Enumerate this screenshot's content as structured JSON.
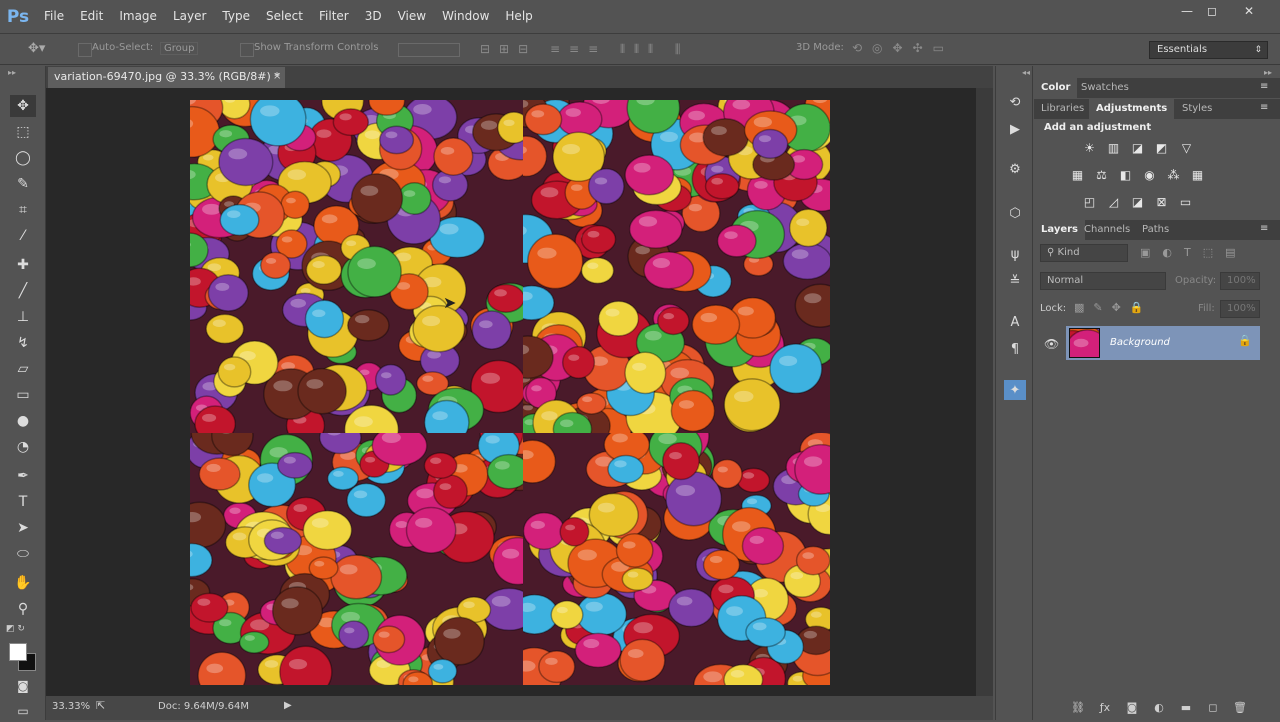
{
  "app": {
    "logo": "Ps",
    "menu": [
      "File",
      "Edit",
      "Image",
      "Layer",
      "Type",
      "Select",
      "Filter",
      "3D",
      "View",
      "Window",
      "Help"
    ],
    "window_controls": {
      "minimize": "—",
      "maximize": "◻",
      "close": "✕"
    }
  },
  "options_bar": {
    "auto_select": "Auto-Select:",
    "group_label": "Group",
    "show_transform": "Show Transform Controls",
    "mode_label": "3D Mode:",
    "workspace": "Essentials"
  },
  "document": {
    "tab_title": "variation-69470.jpg @ 33.3% (RGB/8#) *",
    "tab_close": "×"
  },
  "status": {
    "zoom": "33.33%",
    "doc_info": "Doc: 9.64M/9.64M"
  },
  "panels": {
    "top_tabs": [
      "Color",
      "Swatches"
    ],
    "mid_tabs": [
      "Libraries",
      "Adjustments",
      "Styles"
    ],
    "adjustments_title": "Add an adjustment",
    "layers_tabs": [
      "Layers",
      "Channels",
      "Paths"
    ],
    "filter_kind": "Kind",
    "blend_mode": "Normal",
    "opacity_label": "Opacity:",
    "opacity_value": "100%",
    "lock_label": "Lock:",
    "fill_label": "Fill:",
    "fill_value": "100%",
    "layer_name": "Background"
  },
  "colors": {
    "ui_bg": "#535353",
    "canvas_bg": "#282828",
    "layer_selected": "#7d94b8",
    "ps_blue": "#7bb6f0"
  }
}
